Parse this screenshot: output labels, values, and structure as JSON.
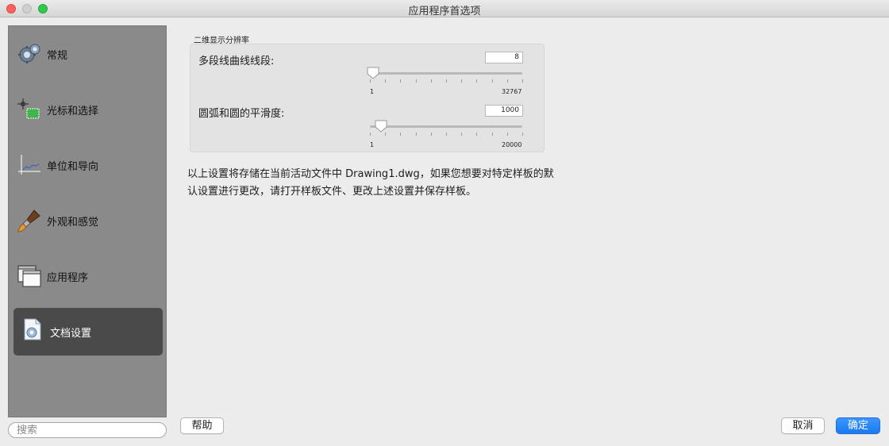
{
  "window": {
    "title": "应用程序首选项"
  },
  "sidebar": {
    "items": [
      {
        "label": "常规",
        "icon": "gears-icon"
      },
      {
        "label": "光标和选择",
        "icon": "cursor-selection-icon"
      },
      {
        "label": "单位和导向",
        "icon": "units-axes-icon"
      },
      {
        "label": "外观和感觉",
        "icon": "paintbrush-icon"
      },
      {
        "label": "应用程序",
        "icon": "windows-icon"
      },
      {
        "label": "文档设置",
        "icon": "document-settings-icon"
      }
    ],
    "active_index": 5
  },
  "search": {
    "placeholder": "搜索",
    "value": ""
  },
  "display_resolution": {
    "title": "二维显示分辨率",
    "polyline": {
      "label": "多段线曲线线段:",
      "value": "8",
      "min_label": "1",
      "max_label": "32767",
      "min": 1,
      "max": 32767,
      "level": 0.0
    },
    "arc": {
      "label": "圆弧和圆的平滑度:",
      "value": "1000",
      "min_label": "1",
      "max_label": "20000",
      "min": 1,
      "max": 20000,
      "level": 0.05
    }
  },
  "note_text": "以上设置将存储在当前活动文件中 Drawing1.dwg，如果您想要对特定样板的默认设置进行更改，请打开样板文件、更改上述设置并保存样板。",
  "buttons": {
    "help": "帮助",
    "cancel": "取消",
    "ok": "确定"
  },
  "colors": {
    "accent": "#1a79ee",
    "sidebar_bg": "#8a8a8a",
    "active_item": "#4a4a4a"
  }
}
